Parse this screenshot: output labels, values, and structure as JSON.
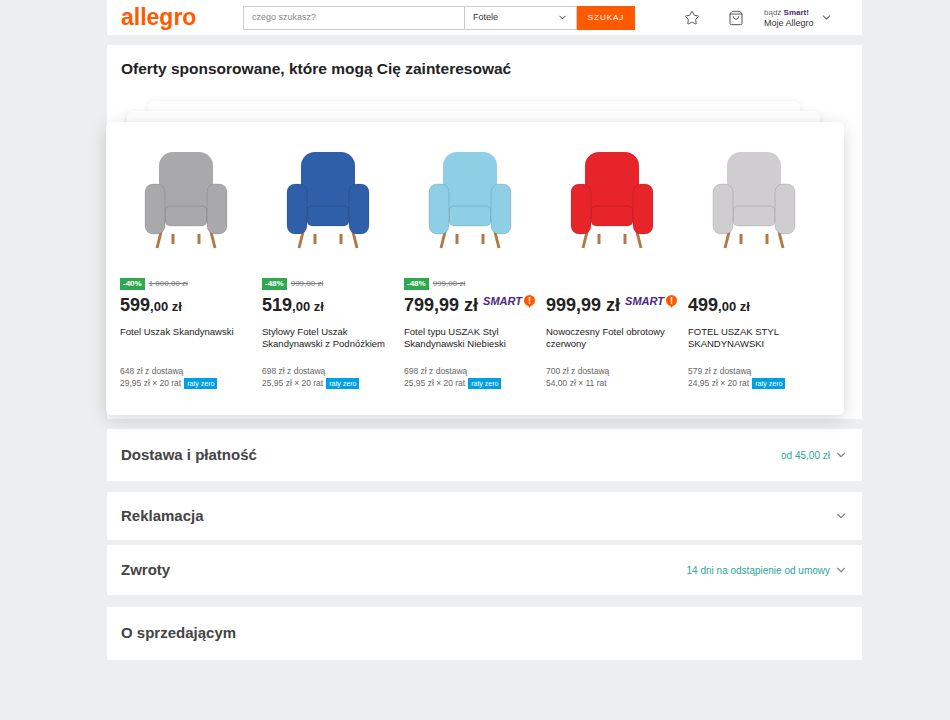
{
  "header": {
    "logo": "allegro",
    "search": {
      "placeholder": "czego szukasz?"
    },
    "category": "Fotele",
    "search_button": "SZUKAJ",
    "smart_prefix": "bądź",
    "smart_label": "Smart!",
    "account": "Moje Allegro"
  },
  "sponsored": {
    "title": "Oferty sponsorowane, które mogą Cię zainteresować",
    "smart_label": "SMART",
    "zero_label": "raty zero",
    "products": [
      {
        "name": "Fotel Uszak Skandynawski",
        "discount": "-40%",
        "old_price": "1 000,00 zł",
        "price": "599",
        "price_suffix": ",00 zł",
        "smart": false,
        "delivery": "648 zł z dostawą",
        "installments": "29,95 zł × 20 rat",
        "zero_installments": true,
        "color": "#a9a9ab"
      },
      {
        "name": "Stylowy Fotel Uszak Skandynawski z Podnóżkiem",
        "discount": "-48%",
        "old_price": "999,00 zł",
        "price": "519",
        "price_suffix": ",00 zł",
        "smart": false,
        "delivery": "698 zł z dostawą",
        "installments": "25,95 zł × 20 rat",
        "zero_installments": true,
        "color": "#2f5fa8"
      },
      {
        "name": "Fotel typu USZAK Styl Skandynawski Niebieski",
        "discount": "-48%",
        "old_price": "999,00 zł",
        "price": "799,99 zł",
        "smart": true,
        "delivery": "698 zł z dostawą",
        "installments": "25,95 zł × 20 rat",
        "zero_installments": true,
        "color": "#8ecfe6"
      },
      {
        "name": "Nowoczesny Fotel obrotowy czerwony",
        "price": "999,99 zł",
        "smart": true,
        "delivery": "700 zł z dostawą",
        "installments": "54,00 zł × 11 rat",
        "zero_installments": false,
        "color": "#e8242b"
      },
      {
        "name": "FOTEL USZAK STYL SKANDYNAWSKI",
        "price": "499",
        "price_suffix": ",00 zł",
        "smart": false,
        "delivery": "579 zł z dostawą",
        "installments": "24,95 zł × 20 rat",
        "zero_installments": true,
        "color": "#cfcdd0"
      }
    ]
  },
  "sections": [
    {
      "title": "Dostawa i płatność",
      "detail": "od 45,00 zł",
      "expandable": true
    },
    {
      "title": "Reklamacja",
      "expandable": true
    },
    {
      "title": "Zwroty",
      "detail": "14 dni na odstąpienie od umowy",
      "expandable": true
    },
    {
      "title": "O sprzedającym",
      "expandable": false
    }
  ]
}
